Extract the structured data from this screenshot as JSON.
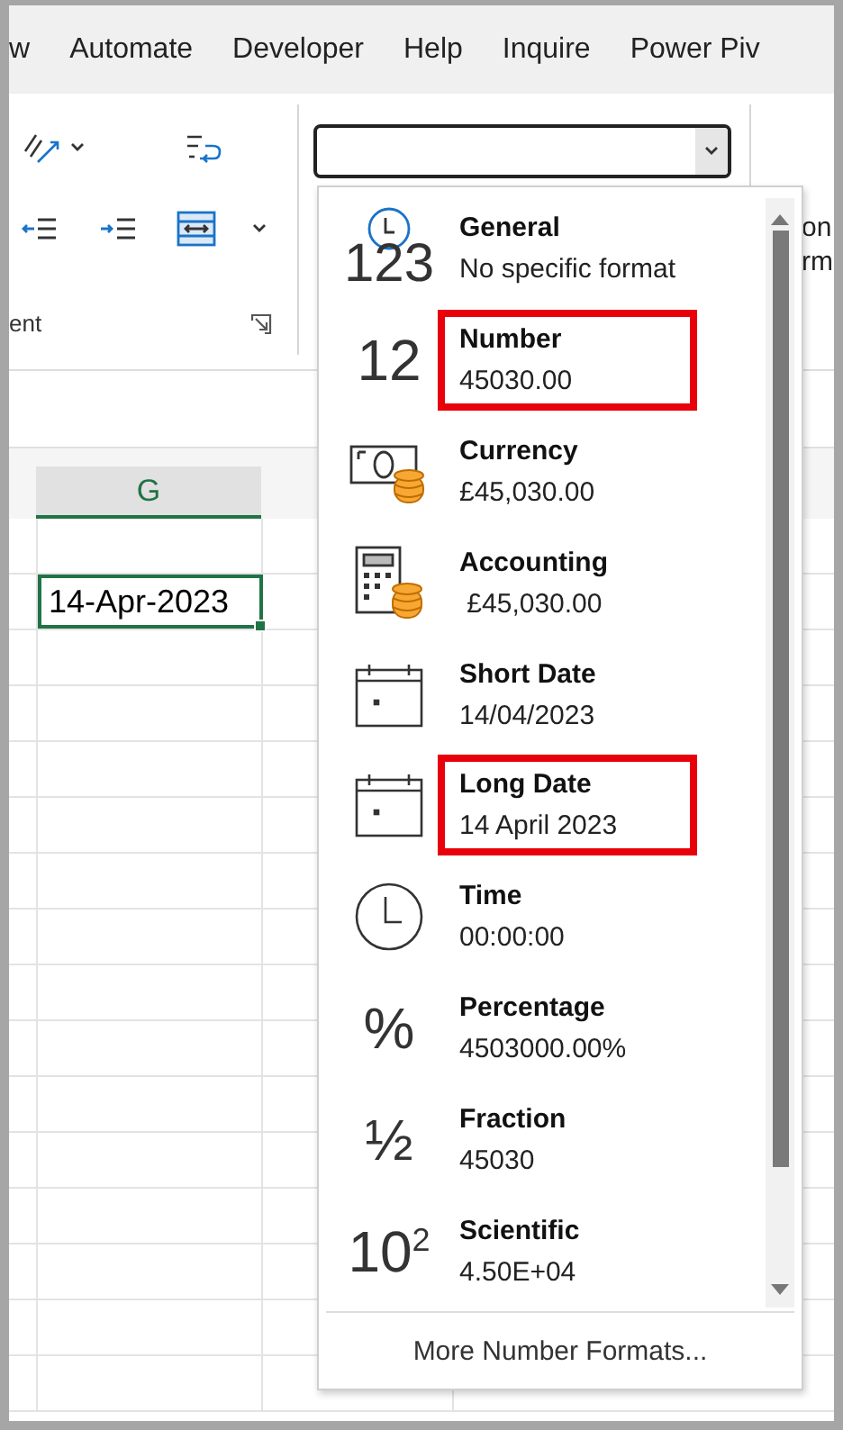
{
  "menu_tabs": [
    "w",
    "Automate",
    "Developer",
    "Help",
    "Inquire",
    "Power Piv"
  ],
  "ribbon": {
    "group_label": "ent",
    "cut_labels": [
      "on",
      "rm"
    ]
  },
  "number_format_box": {
    "expanded": true
  },
  "column_header": {
    "label": "G",
    "selected": true
  },
  "active_cell": {
    "value": "14-Apr-2023"
  },
  "format_list": {
    "items": [
      {
        "kind": "general",
        "glyph": "123",
        "label": "General",
        "example": "No specific format",
        "highlighted": false
      },
      {
        "kind": "glyph",
        "glyph": "12",
        "label": "Number",
        "example": "45030.00",
        "highlighted": true
      },
      {
        "kind": "currency",
        "label": "Currency",
        "example": "£45,030.00",
        "highlighted": false
      },
      {
        "kind": "accounting",
        "label": "Accounting",
        "example": " £45,030.00",
        "highlighted": false
      },
      {
        "kind": "calendar",
        "label": "Short Date",
        "example": "14/04/2023",
        "highlighted": false
      },
      {
        "kind": "calendar",
        "label": "Long Date",
        "example": "14 April 2023",
        "highlighted": true
      },
      {
        "kind": "clock",
        "label": "Time",
        "example": "00:00:00",
        "highlighted": false
      },
      {
        "kind": "glyph",
        "glyph": "%",
        "label": "Percentage",
        "example": "4503000.00%",
        "highlighted": false
      },
      {
        "kind": "glyph",
        "glyph": "½",
        "label": "Fraction",
        "example": "45030",
        "highlighted": false
      },
      {
        "kind": "glyph",
        "glyph": "10$^{2}$",
        "label": "Scientific",
        "example": "4.50E+04",
        "highlighted": false
      }
    ],
    "footer": "More Number Formats..."
  }
}
